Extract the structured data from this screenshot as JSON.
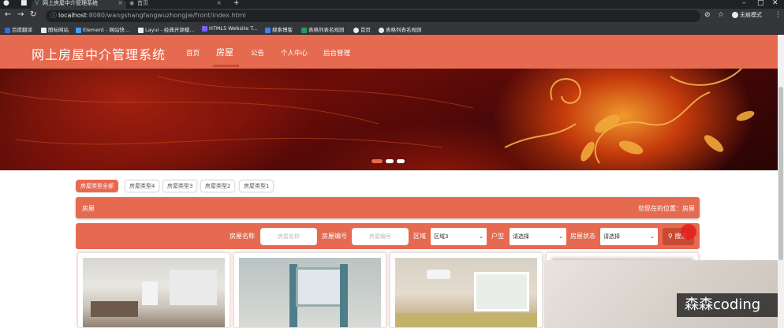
{
  "browser": {
    "tabs": [
      {
        "title": "网上房屋中介管理系统"
      },
      {
        "title": "首页"
      }
    ],
    "new_tab": "+",
    "url_host": "localhost",
    "url_rest": ":8080/wangshangfangwuzhongjie/front/index.html",
    "incognito_label": "无痕模式",
    "bookmarks": [
      {
        "label": "百度翻译",
        "color": "#2f6de1"
      },
      {
        "label": "图标网站",
        "color": "#e8eaed"
      },
      {
        "label": "Element - 网站快...",
        "color": "#409eff"
      },
      {
        "label": "Layui - 经典开源模...",
        "color": "#e8eaed"
      },
      {
        "label": "HTML5 Website T...",
        "color": "#7b61ff"
      },
      {
        "label": "搜索博客",
        "color": "#3b82f6"
      },
      {
        "label": "表格列表名规则",
        "color": "#1e9e5a"
      },
      {
        "label": "首页",
        "color": "#e8eaed"
      },
      {
        "label": "表格列表名规则",
        "color": "#e8eaed"
      }
    ]
  },
  "header": {
    "site_title": "网上房屋中介管理系统",
    "nav": [
      "首页",
      "房屋",
      "公告",
      "个人中心",
      "后台管理"
    ],
    "active_nav": "房屋",
    "brand_color": "#e56a4f"
  },
  "banner": {
    "slides": 3,
    "active_slide": 1
  },
  "type_tabs": [
    "房屋类型全部",
    "房屋类型4",
    "房屋类型3",
    "房屋类型2",
    "房屋类型1"
  ],
  "breadcrumb": {
    "title": "房屋",
    "location": "您现在的位置：房屋"
  },
  "search": {
    "name_label": "房屋名称",
    "name_placeholder": "房屋名称",
    "number_label": "房屋编号",
    "number_placeholder": "房屋编号",
    "area_label": "区域",
    "area_value": "区域3",
    "layout_label": "户型",
    "layout_value": "请选择",
    "status_label": "房屋状态",
    "status_value": "请选择",
    "search_button": "搜索"
  },
  "watermark": "森森coding"
}
